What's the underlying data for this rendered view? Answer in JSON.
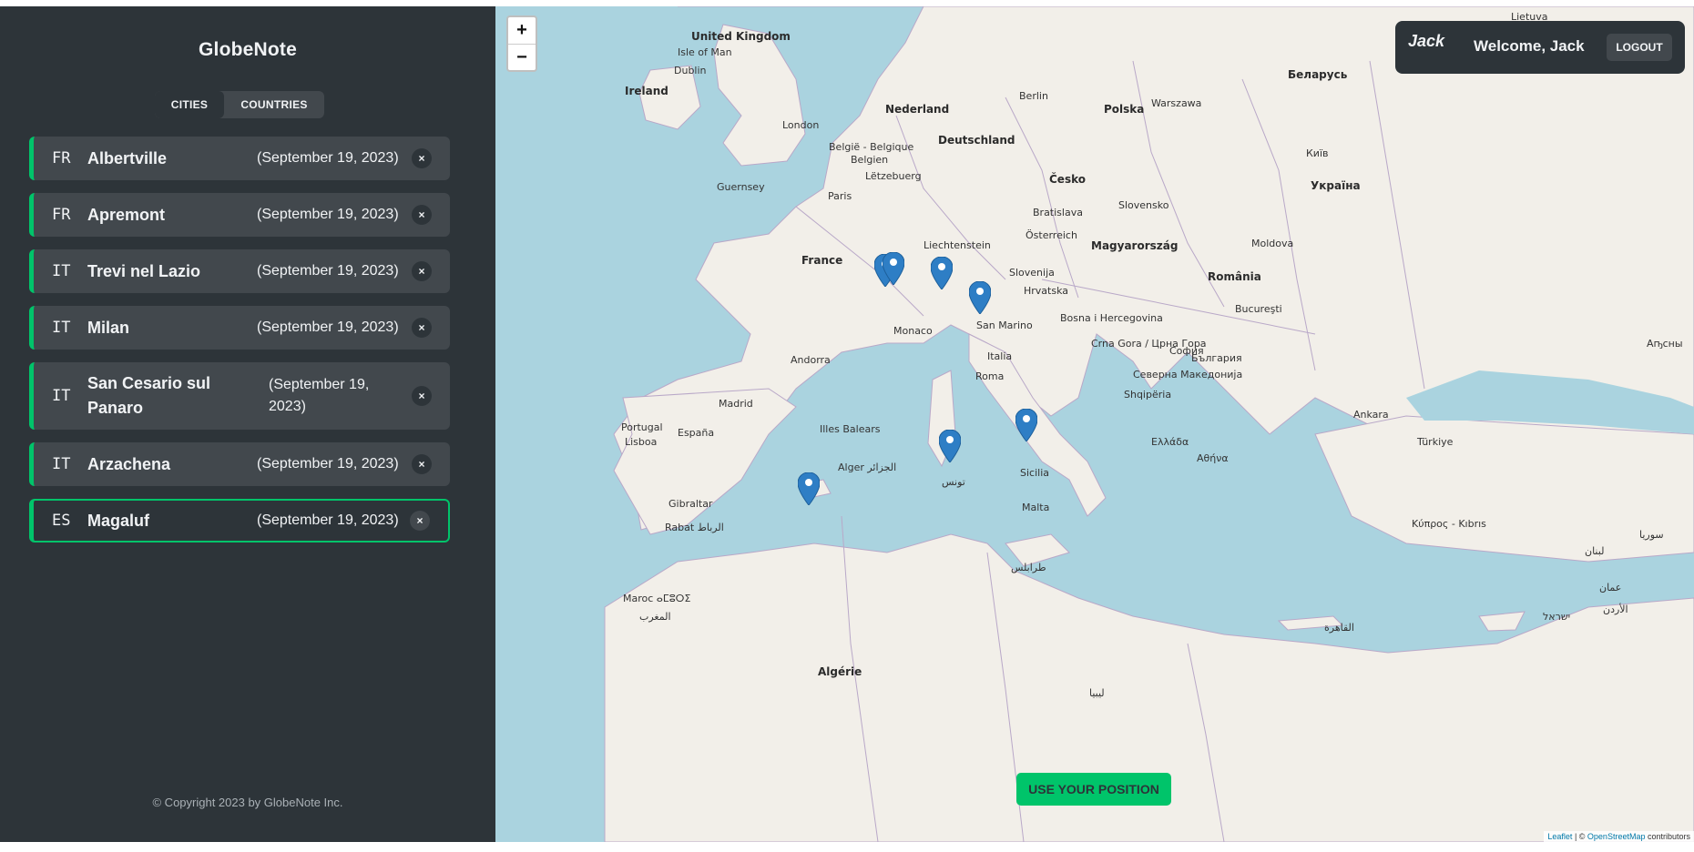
{
  "sidebar": {
    "logo": "GlobeNote",
    "tabs": [
      {
        "label": "CITIES"
      },
      {
        "label": "COUNTRIES"
      }
    ],
    "cities": [
      {
        "flag": "FR",
        "name": "Albertville",
        "date": "(September 19, 2023)"
      },
      {
        "flag": "FR",
        "name": "Apremont",
        "date": "(September 19, 2023)"
      },
      {
        "flag": "IT",
        "name": "Trevi nel Lazio",
        "date": "(September 19, 2023)"
      },
      {
        "flag": "IT",
        "name": "Milan",
        "date": "(September 19, 2023)"
      },
      {
        "flag": "IT",
        "name": "San Cesario sul Panaro",
        "date": "(September 19, 2023)"
      },
      {
        "flag": "IT",
        "name": "Arzachena",
        "date": "(September 19, 2023)"
      },
      {
        "flag": "ES",
        "name": "Magaluf",
        "date": "(September 19, 2023)"
      }
    ],
    "delete_label": "×",
    "copyright": "© Copyright 2023 by GlobeNote Inc."
  },
  "map": {
    "zoom_in": "+",
    "zoom_out": "−",
    "use_position": "USE YOUR POSITION",
    "attribution_leaflet": "Leaflet",
    "attribution_sep": " | © ",
    "attribution_osm": "OpenStreetMap",
    "attribution_tail": " contributors",
    "labels": [
      "United Kingdom",
      "Isle of Man",
      "Dublin",
      "Ireland",
      "London",
      "Nederland",
      "Berlin",
      "Polska",
      "Warszawa",
      "Беларусь",
      "Lietuva",
      "België - Belgique",
      "Belgien",
      "Deutschland",
      "Lëtzebuerg",
      "Guernsey",
      "Paris",
      "Česko",
      "Slovensko",
      "Київ",
      "Україна",
      "Bratislava",
      "Liechtenstein",
      "Österreich",
      "Magyarország",
      "Moldova",
      "France",
      "Slovenija",
      "Hrvatska",
      "România",
      "Bucureşti",
      "Monaco",
      "San Marino",
      "Bosna i Hercegovina",
      "Crna Gora / Црна Гора",
      "София",
      "България",
      "Andorra",
      "Italia",
      "Roma",
      "Shqipëria",
      "Северна Македонија",
      "Madrid",
      "España",
      "Portugal",
      "Lisboa",
      "Illes Balears",
      "Ελλάδα",
      "Αθήνα",
      "Ankara",
      "Türkiye",
      "Alger الجزائر",
      "تونس",
      "Sicilia",
      "Malta",
      "Gibraltar",
      "Rabat الرباط",
      "Maroc ⴰⵎⵓⵔⵉ",
      "المغرب",
      "Algérie",
      "ليبيا",
      "طرابلس",
      "Κύπρος - Kıbrıs",
      "سوريا",
      "لبنان",
      "عمان",
      "الأردن",
      "ישראל",
      "القاهرة",
      "Аҧсны"
    ]
  },
  "user": {
    "avatar_alt": "Jack",
    "welcome": "Welcome, Jack",
    "logout": "LOGOUT"
  },
  "colors": {
    "accent": "#00c46a",
    "panel": "#2d3439",
    "item": "#42484d",
    "water": "#aad3df",
    "land": "#f2efe9"
  }
}
